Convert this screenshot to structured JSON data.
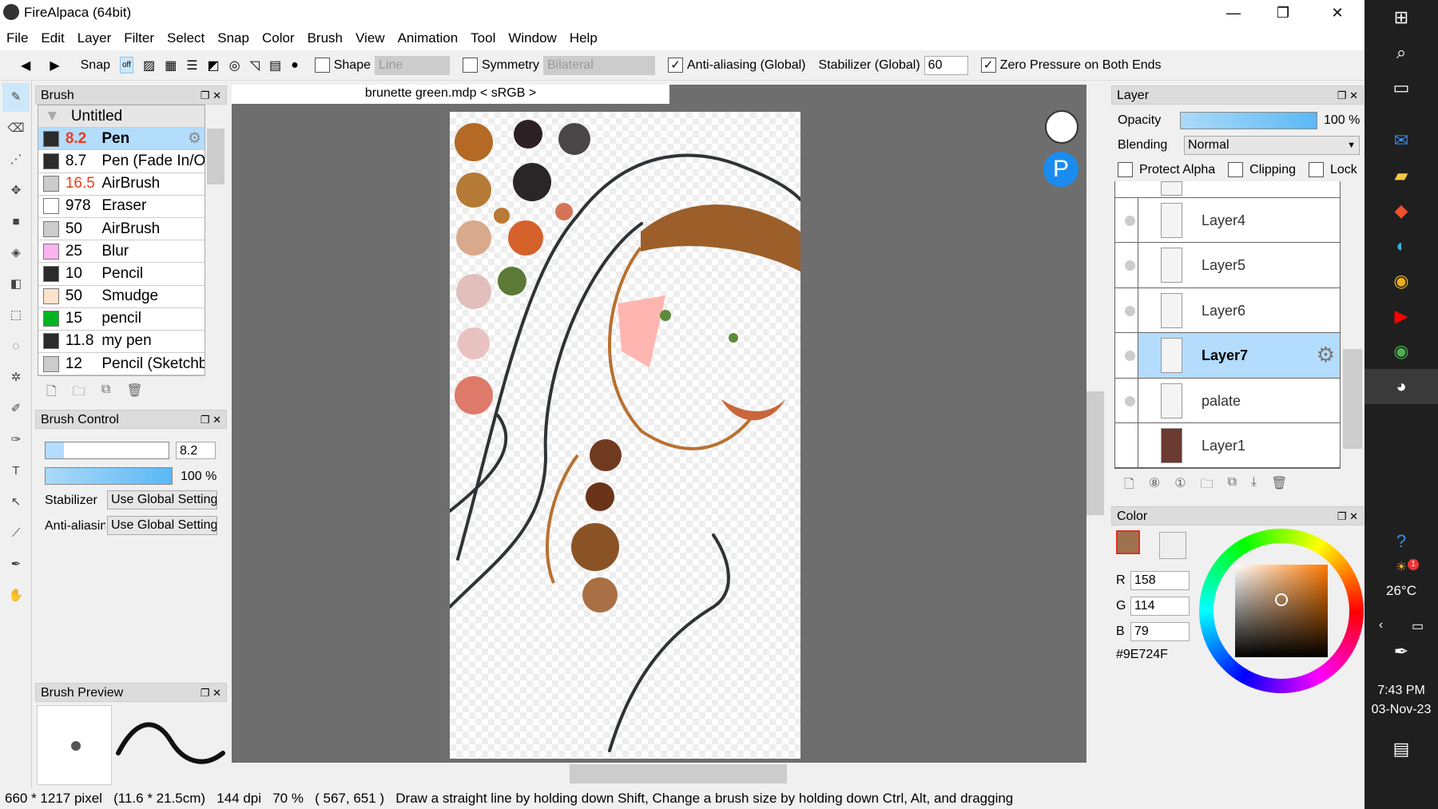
{
  "window": {
    "title": "FireAlpaca (64bit)"
  },
  "menu": [
    "File",
    "Edit",
    "Layer",
    "Filter",
    "Select",
    "Snap",
    "Color",
    "Brush",
    "View",
    "Animation",
    "Tool",
    "Window",
    "Help"
  ],
  "toolbar": {
    "snap_label": "Snap",
    "snap_off": "off",
    "shape_label": "Shape",
    "shape_value": "Line",
    "shape_checked": false,
    "symmetry_label": "Symmetry",
    "symmetry_value": "Bilateral",
    "symmetry_checked": false,
    "antialias_label": "Anti-aliasing (Global)",
    "antialias_checked": true,
    "stabilizer_label": "Stabilizer (Global)",
    "stabilizer_value": "60",
    "zero_pressure_label": "Zero Pressure on Both Ends",
    "zero_pressure_checked": true
  },
  "brush_panel": {
    "title": "Brush",
    "group": "Untitled",
    "items": [
      {
        "size": "8.2",
        "name": "Pen",
        "color": "#2b2b2b",
        "size_red": true,
        "selected": true
      },
      {
        "size": "8.7",
        "name": "Pen (Fade In/Out)",
        "color": "#2b2b2b"
      },
      {
        "size": "16.5",
        "name": "AirBrush",
        "color": "#cccccc",
        "size_red": true
      },
      {
        "size": "978",
        "name": "Eraser",
        "color": "#ffffff"
      },
      {
        "size": "50",
        "name": "AirBrush",
        "color": "#cccccc"
      },
      {
        "size": "25",
        "name": "Blur",
        "color": "#f9b3ee"
      },
      {
        "size": "10",
        "name": "Pencil",
        "color": "#2b2b2b"
      },
      {
        "size": "50",
        "name": "Smudge",
        "color": "#fde3cb"
      },
      {
        "size": "15",
        "name": "pencil",
        "color": "#00b521"
      },
      {
        "size": "11.8",
        "name": "my pen",
        "color": "#2b2b2b"
      },
      {
        "size": "12",
        "name": "Pencil (Sketchbook)",
        "color": "#cccccc"
      }
    ]
  },
  "brush_control": {
    "title": "Brush Control",
    "size": "8.2",
    "opacity": "100 %",
    "stabilizer_label": "Stabilizer",
    "stabilizer_value": "Use Global Setting",
    "antialias_label": "Anti-aliasing",
    "antialias_value": "Use Global Setting"
  },
  "brush_preview": {
    "title": "Brush Preview"
  },
  "document": {
    "tab": "brunette green.mdp < sRGB >"
  },
  "layer_panel": {
    "title": "Layer",
    "opacity_label": "Opacity",
    "opacity": "100 %",
    "blending_label": "Blending",
    "blending": "Normal",
    "protect_alpha": "Protect Alpha",
    "clipping": "Clipping",
    "lock": "Lock",
    "layers": [
      {
        "name": "Layer4"
      },
      {
        "name": "Layer5"
      },
      {
        "name": "Layer6"
      },
      {
        "name": "Layer7",
        "selected": true
      },
      {
        "name": "palate"
      },
      {
        "name": "Layer1"
      }
    ]
  },
  "color_panel": {
    "title": "Color",
    "r_label": "R",
    "r": "158",
    "g_label": "G",
    "g": "114",
    "b_label": "B",
    "b": "79",
    "hex": "#9E724F"
  },
  "status": {
    "size": "660 * 1217 pixel",
    "physical": "(11.6 * 21.5cm)",
    "dpi": "144 dpi",
    "zoom": "70 %",
    "coords": "( 567, 651 )",
    "hint": "Draw a straight line by holding down Shift, Change a brush size by holding down Ctrl, Alt, and dragging"
  },
  "taskbar": {
    "weather": "26°C",
    "time": "7:43 PM",
    "date": "03-Nov-23",
    "badge": "1"
  },
  "colors": {
    "selection": "#b3dcfd",
    "accent": "#5bb8f5",
    "fg_color": "#9e724f"
  }
}
